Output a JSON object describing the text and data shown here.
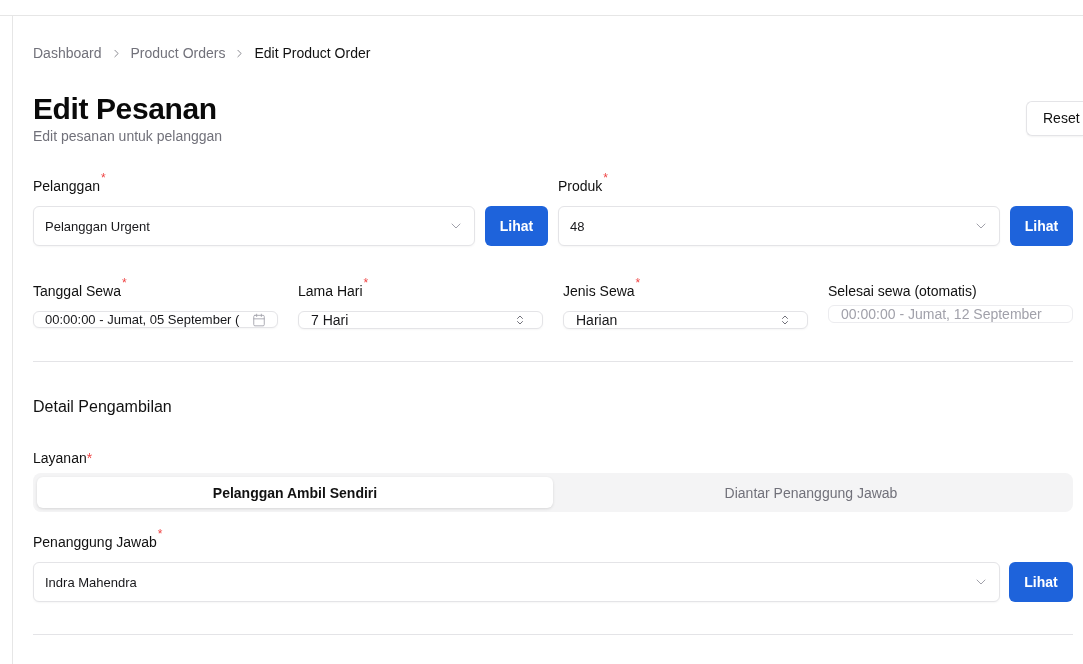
{
  "breadcrumb": [
    {
      "label": "Dashboard",
      "current": false
    },
    {
      "label": "Product Orders",
      "current": false
    },
    {
      "label": "Edit Product Order",
      "current": true
    }
  ],
  "page": {
    "title": "Edit Pesanan",
    "subtitle": "Edit pesanan untuk pelanggan",
    "action": "Reset"
  },
  "order_fields": [
    {
      "kind": "lookup",
      "label": "Pelanggan",
      "marker": "*",
      "value": "Pelanggan Urgent",
      "button": "Lihat"
    },
    {
      "kind": "lookup",
      "label": "Produk",
      "marker": "*",
      "value": "48",
      "button": "Lihat"
    }
  ],
  "rental_fields": [
    {
      "kind": "date",
      "label": "Tanggal Sewa",
      "marker": "*",
      "value": "00:00:00 - Jumat, 05 September (",
      "disabled": false
    },
    {
      "kind": "stepper",
      "label": "Lama Hari",
      "marker": "*",
      "value": "7 Hari",
      "disabled": false
    },
    {
      "kind": "stepper",
      "label": "Jenis Sewa",
      "marker": "*",
      "value": "Harian",
      "disabled": false
    },
    {
      "kind": "readonly",
      "label": "Selesai sewa (otomatis)",
      "value": "00:00:00 - Jumat, 12 September",
      "disabled": true
    }
  ],
  "pickup": {
    "heading": "Detail Pengambilan",
    "service": {
      "label": "Layanan",
      "marker": "*",
      "options": [
        {
          "label": "Pelanggan Ambil Sendiri",
          "selected": true
        },
        {
          "label": "Diantar Penanggung Jawab",
          "selected": false
        }
      ]
    },
    "responsible": {
      "kind": "lookup",
      "label": "Penanggung Jawab",
      "marker": "*",
      "value": "Indra Mahendra",
      "button": "Lihat"
    }
  }
}
